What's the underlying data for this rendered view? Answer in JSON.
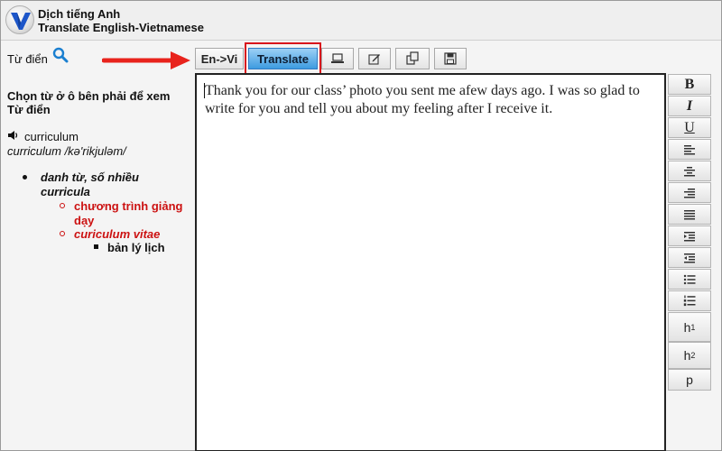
{
  "header": {
    "title_line1": "Dịch tiếng Anh",
    "title_line2": "Translate English-Vietnamese"
  },
  "sidebar": {
    "dict_label": "Từ điển",
    "prompt": "Chọn từ ở ô bên phải để xem Từ điển",
    "word": "curriculum",
    "pronunciation": "curriculum /kə'rikjuləm/",
    "entry": {
      "pos": "danh từ, số nhiều",
      "plural": "curricula",
      "meaning1": "chương trình giảng dạy",
      "meaning2": "curiculum vitae",
      "sub_meaning": "bản lý lịch"
    }
  },
  "toolbar": {
    "direction_label": "En->Vi",
    "translate_label": "Translate",
    "icons": [
      "laptop-icon",
      "edit-icon",
      "copy-icon",
      "save-icon"
    ]
  },
  "editor": {
    "text": "Thank you for our class’ photo you sent me afew days ago. I was so glad to write for you and tell you about my feeling after I receive it."
  },
  "format": {
    "bold": "B",
    "italic": "I",
    "underline": "U",
    "h1_base": "h",
    "h1_sup": "1",
    "h2_base": "h",
    "h2_sup": "2",
    "p": "p"
  },
  "colors": {
    "highlight_border": "#d8121c",
    "arrow": "#e8231c",
    "translate_button": "#3e9be0",
    "definition_red": "#cc1111",
    "search_icon": "#1a7fd0"
  }
}
